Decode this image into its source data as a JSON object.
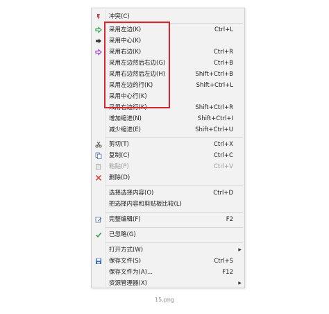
{
  "menu": {
    "items": [
      {
        "label": "冲突(C)",
        "shortcut": "",
        "icon": "conflict-icon"
      },
      {
        "label": "采用左边(K)",
        "shortcut": "Ctrl+L",
        "icon": "green-arrow-icon"
      },
      {
        "label": "采用中心(K)",
        "shortcut": "",
        "icon": "black-arrow-icon"
      },
      {
        "label": "采用右边(K)",
        "shortcut": "Ctrl+R",
        "icon": "purple-arrow-icon"
      },
      {
        "label": "采用左边然后右边(G)",
        "shortcut": "Ctrl+B",
        "icon": ""
      },
      {
        "label": "采用右边然后左边(H)",
        "shortcut": "Shift+Ctrl+B",
        "icon": ""
      },
      {
        "label": "采用左边的行(K)",
        "shortcut": "Shift+Ctrl+L",
        "icon": ""
      },
      {
        "label": "采用中心行(K)",
        "shortcut": "",
        "icon": ""
      },
      {
        "label": "采用右边行(K)",
        "shortcut": "Shift+Ctrl+R",
        "icon": ""
      },
      {
        "label": "增加缩进(N)",
        "shortcut": "Shift+Ctrl+I",
        "icon": ""
      },
      {
        "label": "减少缩进(E)",
        "shortcut": "Shift+Ctrl+U",
        "icon": ""
      },
      {
        "label": "剪切(T)",
        "shortcut": "Ctrl+X",
        "icon": "scissors-icon"
      },
      {
        "label": "复制(C)",
        "shortcut": "Ctrl+C",
        "icon": "copy-icon"
      },
      {
        "label": "粘贴(P)",
        "shortcut": "Ctrl+V",
        "icon": "paste-icon",
        "disabled": true
      },
      {
        "label": "删除(D)",
        "shortcut": "",
        "icon": "delete-x-icon"
      },
      {
        "label": "选择选择内容(O)",
        "shortcut": "Ctrl+D",
        "icon": ""
      },
      {
        "label": "把选择内容和剪贴板比较(L)",
        "shortcut": "",
        "icon": ""
      },
      {
        "label": "完整编辑(F)",
        "shortcut": "F2",
        "icon": "edit-icon"
      },
      {
        "label": "已忽略(G)",
        "shortcut": "",
        "icon": "checkmark-icon"
      },
      {
        "label": "打开方式(W)",
        "shortcut": "",
        "icon": "",
        "submenu": true
      },
      {
        "label": "保存文件(S)",
        "shortcut": "Ctrl+S",
        "icon": "save-icon"
      },
      {
        "label": "保存文件为(A)...",
        "shortcut": "F12",
        "icon": ""
      },
      {
        "label": "资源管理器(X)",
        "shortcut": "",
        "icon": "",
        "submenu": true
      }
    ],
    "submenu_arrow": "▶"
  },
  "caption": "15.png",
  "colors": {
    "highlight": "#d9262c",
    "green_arrow": "#3aa655",
    "purple_arrow": "#a04ac8",
    "delete_red": "#d23a2a",
    "check_green": "#2e9e3e"
  }
}
